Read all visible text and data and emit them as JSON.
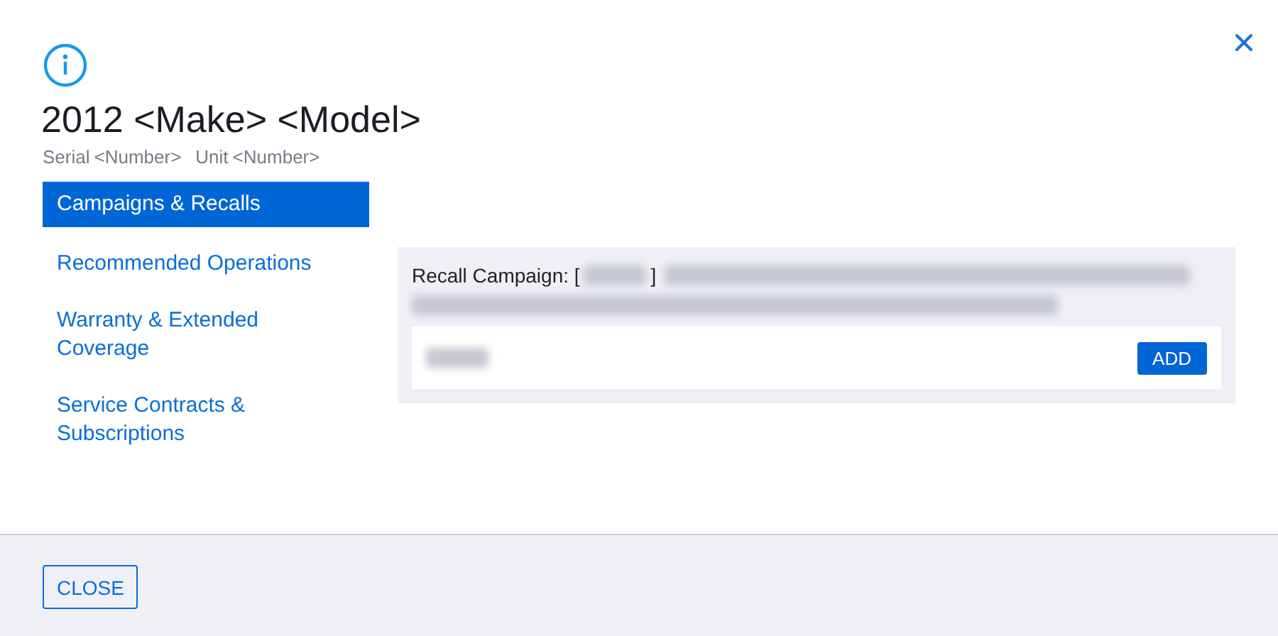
{
  "header": {
    "title": "2012 <Make> <Model>",
    "serial_label": "Serial",
    "serial_value": "<Number>",
    "unit_label": "Unit",
    "unit_value": "<Number>"
  },
  "sidebar": {
    "items": [
      {
        "label": "Campaigns & Recalls",
        "selected": true
      },
      {
        "label": "Recommended Operations",
        "selected": false
      },
      {
        "label": "Warranty & Extended Coverage",
        "selected": false
      },
      {
        "label": "Service Contracts & Subscriptions",
        "selected": false
      }
    ]
  },
  "recall": {
    "label": "Recall Campaign: [",
    "bracket_close": "]",
    "button": "ADD"
  },
  "footer": {
    "button": "CLOSE"
  }
}
